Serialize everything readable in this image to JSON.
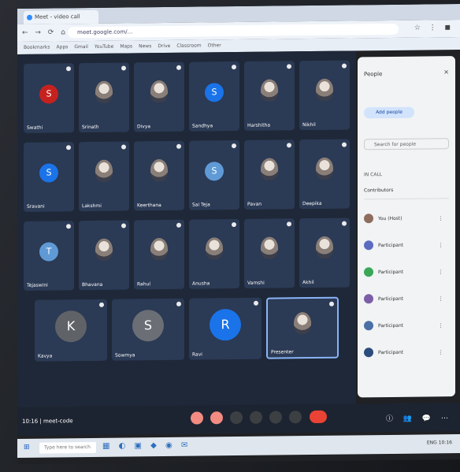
{
  "browser": {
    "tab_label": "Meet - video call",
    "url": "meet.google.com/...",
    "nav_icons": "← → ⟳ ⌂",
    "ext_icons": "☆ ⋮ ◼",
    "bookmarks": [
      "Bookmarks",
      "Apps",
      "Gmail",
      "YouTube",
      "Maps",
      "News",
      "Drive",
      "Classroom",
      "Other"
    ]
  },
  "tiles": [
    {
      "id": "t1",
      "kind": "letter",
      "letter": "S",
      "name": "Swathi",
      "avColor": "#c5221f"
    },
    {
      "id": "t2",
      "kind": "photo",
      "name": "Srinath"
    },
    {
      "id": "t3",
      "kind": "photo",
      "name": "Divya"
    },
    {
      "id": "t4",
      "kind": "letter",
      "letter": "S",
      "name": "Sandhya",
      "avColor": "#1a73e8"
    },
    {
      "id": "t5",
      "kind": "photo",
      "name": "Harshitha"
    },
    {
      "id": "t6",
      "kind": "photo",
      "name": "Nikhil"
    },
    {
      "id": "t7",
      "kind": "letter",
      "letter": "S",
      "name": "Sravani",
      "avColor": "#1a73e8"
    },
    {
      "id": "t8",
      "kind": "photo",
      "name": "Lakshmi"
    },
    {
      "id": "t9",
      "kind": "photo",
      "name": "Keerthana"
    },
    {
      "id": "t10",
      "kind": "letter",
      "letter": "S",
      "name": "Sai Teja",
      "avColor": "#5f9ad6"
    },
    {
      "id": "t11",
      "kind": "photo",
      "name": "Pavan"
    },
    {
      "id": "t12",
      "kind": "photo",
      "name": "Deepika"
    },
    {
      "id": "t13",
      "kind": "letter",
      "letter": "T",
      "name": "Tejaswini",
      "avColor": "#5f9ad6"
    },
    {
      "id": "t14",
      "kind": "photo",
      "name": "Bhavana"
    },
    {
      "id": "t15",
      "kind": "photo",
      "name": "Rahul"
    },
    {
      "id": "t16",
      "kind": "photo",
      "name": "Anusha"
    },
    {
      "id": "t17",
      "kind": "photo",
      "name": "Vamshi"
    },
    {
      "id": "t18",
      "kind": "photo",
      "name": "Akhil"
    },
    {
      "id": "t19",
      "kind": "letter",
      "letter": "K",
      "name": "Kavya",
      "avColor": "#5f6368"
    },
    {
      "id": "t20",
      "kind": "letter",
      "letter": "S",
      "name": "Sowmya",
      "avColor": "#6b6f75"
    },
    {
      "id": "t21",
      "kind": "letter",
      "letter": "R",
      "name": "Ravi",
      "avColor": "#1a73e8"
    },
    {
      "id": "t22",
      "kind": "photo",
      "name": "Presenter",
      "highlight": true
    }
  ],
  "bottom": {
    "meeting_info": "10:16 | meet-code",
    "right_icons": "ⓘ 👥 💬 ⋯"
  },
  "panel": {
    "title": "People",
    "close": "✕",
    "add_label": "Add people",
    "search_placeholder": "Search for people",
    "section": "IN CALL",
    "group_label": "Contributors",
    "people": [
      {
        "name": "You (Host)",
        "color": "#8e6c5e"
      },
      {
        "name": "Participant",
        "color": "#5c6bc0"
      },
      {
        "name": "Participant",
        "color": "#3aa757"
      },
      {
        "name": "Participant",
        "color": "#7b5ea7"
      },
      {
        "name": "Participant",
        "color": "#4a6fa5"
      },
      {
        "name": "Participant",
        "color": "#2c4c7c"
      }
    ]
  },
  "taskbar": {
    "start": "⊞",
    "search": "Type here to search",
    "apps": "▦ ◐ ▣ ◆ ◉ ✉",
    "tray": "ENG  10:16"
  }
}
